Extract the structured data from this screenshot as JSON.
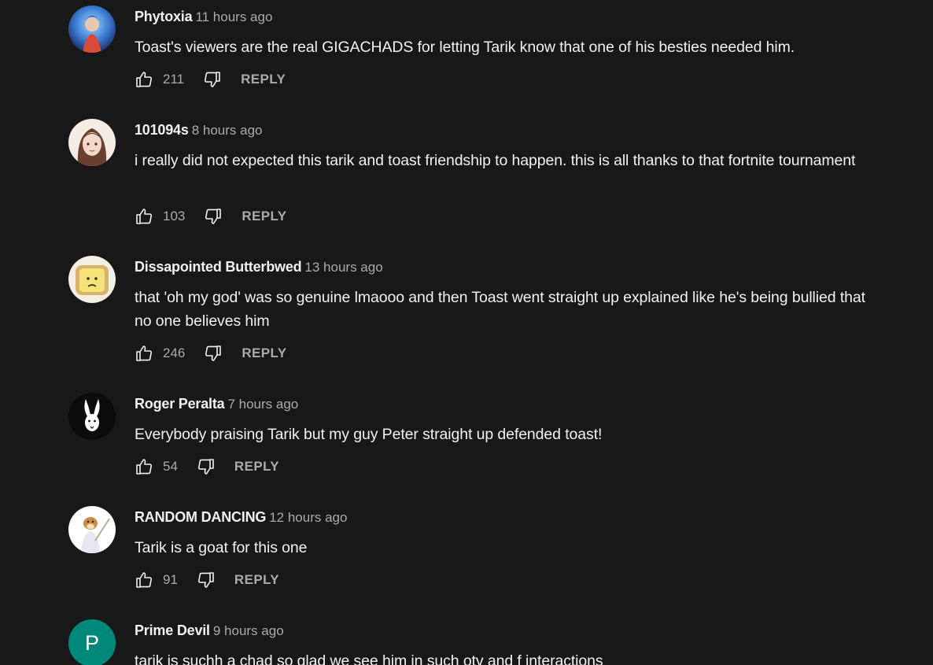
{
  "colors": {
    "background": "#181818",
    "text_primary": "#f1f1f1",
    "text_secondary": "#aaaaaa"
  },
  "reply_label": "REPLY",
  "comments": [
    {
      "author": "Phytoxia",
      "time": "11 hours ago",
      "text": "Toast's viewers are the real GIGACHADS for letting Tarik know that one of his besties needed him.",
      "likes": "211",
      "avatar_icon": "anime-character-avatar"
    },
    {
      "author": "101094s",
      "time": "8 hours ago",
      "text": "i really did not expected this tarik and toast friendship to happen. this is all thanks to that fortnite tournament",
      "likes": "103",
      "avatar_icon": "illustrated-girl-avatar"
    },
    {
      "author": "Dissapointed Butterbwed",
      "time": "13 hours ago",
      "text": "that 'oh my god' was so genuine lmaooo and then Toast went straight up explained like he's being bullied that no one believes him",
      "likes": "246",
      "avatar_icon": "sad-butter-toast-avatar"
    },
    {
      "author": "Roger Peralta",
      "time": "7 hours ago",
      "text": "Everybody praising Tarik but my guy Peter straight up defended toast!",
      "likes": "54",
      "avatar_icon": "white-rabbit-avatar"
    },
    {
      "author": "RANDOM DANCING",
      "time": "12 hours ago",
      "text": "Tarik is a goat for this one",
      "likes": "91",
      "avatar_icon": "dog-with-sword-avatar"
    },
    {
      "author": "Prime Devil",
      "time": "9 hours ago",
      "text": "tarik is suchh a chad so glad we see him in such otv and f interactions",
      "likes": "",
      "avatar_letter": "P",
      "avatar_color": "#00897b",
      "avatar_icon": "letter-avatar"
    }
  ]
}
